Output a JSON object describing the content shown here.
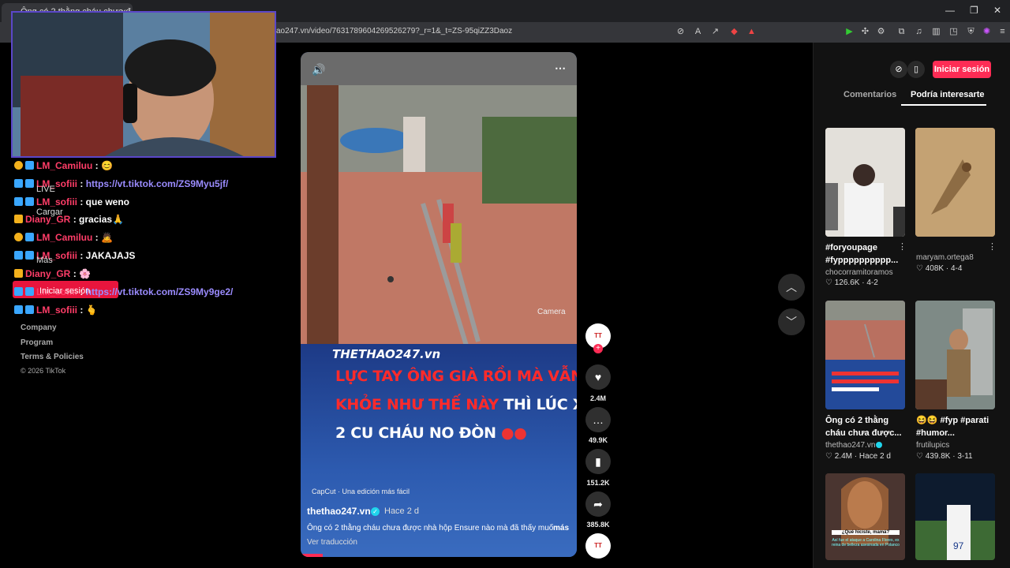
{
  "browser": {
    "tab_title": "Ông có 2 thằng cháu chưa đ...",
    "tab_close": "×",
    "url": "ao247.vn/video/7631789604269526279?_r=1&_t=ZS-95qiZZ3Daoz",
    "window_controls": [
      "—",
      "❐",
      "✕"
    ]
  },
  "chat": {
    "lines": [
      {
        "user": "LM_Camiluu",
        "text": " : ",
        "emoji": "😊"
      },
      {
        "user": "LM_sofiii",
        "text": " : ",
        "link": "https://vt.tiktok.com/ZS9Myu5jf/"
      },
      {
        "user": "LM_sofiii",
        "text": " : que weno"
      },
      {
        "user": "Diany_GR",
        "text": " : gracias",
        "emoji": "🙏"
      },
      {
        "user": "LM_Camiluu",
        "text": " : ",
        "emoji": "🙇"
      },
      {
        "user": "LM_sofiii",
        "text": " : JAKAJAJS"
      },
      {
        "user": "Diany_GR",
        "text": " : ",
        "emoji": "🌸"
      },
      {
        "user": "LM_sofiii",
        "text": " : ",
        "link": "https://vt.tiktok.com/ZS9My9ge2/"
      },
      {
        "user": "LM_sofiii",
        "text": " : ",
        "emoji": "🫰"
      }
    ],
    "ghost_labels": [
      "LIVE",
      "Cargar",
      "Más",
      "Iniciar sesión"
    ]
  },
  "footer": {
    "links": [
      "Company",
      "Program",
      "Terms & Policies"
    ],
    "copyright": "© 2026 TikTok"
  },
  "video": {
    "watermark": "THETHAO247.vn",
    "headline_lines": [
      {
        "pre": "",
        "red": "LỰC TAY ÔNG GIÀ RỒI MÀ VẪN",
        "post": ""
      },
      {
        "pre": "",
        "red": "KHỎE NHƯ THẾ NÀY",
        "post": " THÌ LÚC XUỐNG"
      },
      {
        "pre": "2 CU CHÁU NO ĐÒN ",
        "red": "",
        "post": ""
      }
    ],
    "capcut": "CapCut · Una edición más fácil",
    "author": "thethao247.vn",
    "time": "Hace 2 d",
    "description": "Ông có 2 thằng cháu chưa được nhà hộp Ensure nào mà đã thấy muốn",
    "more": "más",
    "translate": "Ver traducción"
  },
  "actions": {
    "likes": "2.4M",
    "comments": "49.9K",
    "saves": "151.2K",
    "shares": "385.8K"
  },
  "panel": {
    "login": "Iniciar sesión",
    "tabs": [
      "Comentarios",
      "Podría interesarte"
    ],
    "cards": [
      {
        "title": "#foryoupage #fypppppppppp...",
        "author": "chocorramitoramos",
        "likes": "126.6K",
        "date": "4-2"
      },
      {
        "title": "",
        "author": "maryam.ortega8",
        "likes": "408K",
        "date": "4-4"
      },
      {
        "title": "Ông có 2 thằng cháu chưa được...",
        "author": "thethao247.vn",
        "likes": "2.4M",
        "date": "Hace 2 d"
      },
      {
        "title": "😆😆 #fyp #parati #humor...",
        "author": "frutilupics",
        "likes": "439.8K",
        "date": "3-11"
      }
    ],
    "overlay_texts": [
      "¿Qué hiciste, mamá?",
      "Así fue el ataque a Carolina Flores, ex reina de belleza asesinada en Polanco"
    ]
  },
  "colors": {
    "accent": "#fe2c55",
    "chat_user": "#ff3d68",
    "chat_link": "#9b8cff",
    "webcam_border": "#5b47c9"
  }
}
